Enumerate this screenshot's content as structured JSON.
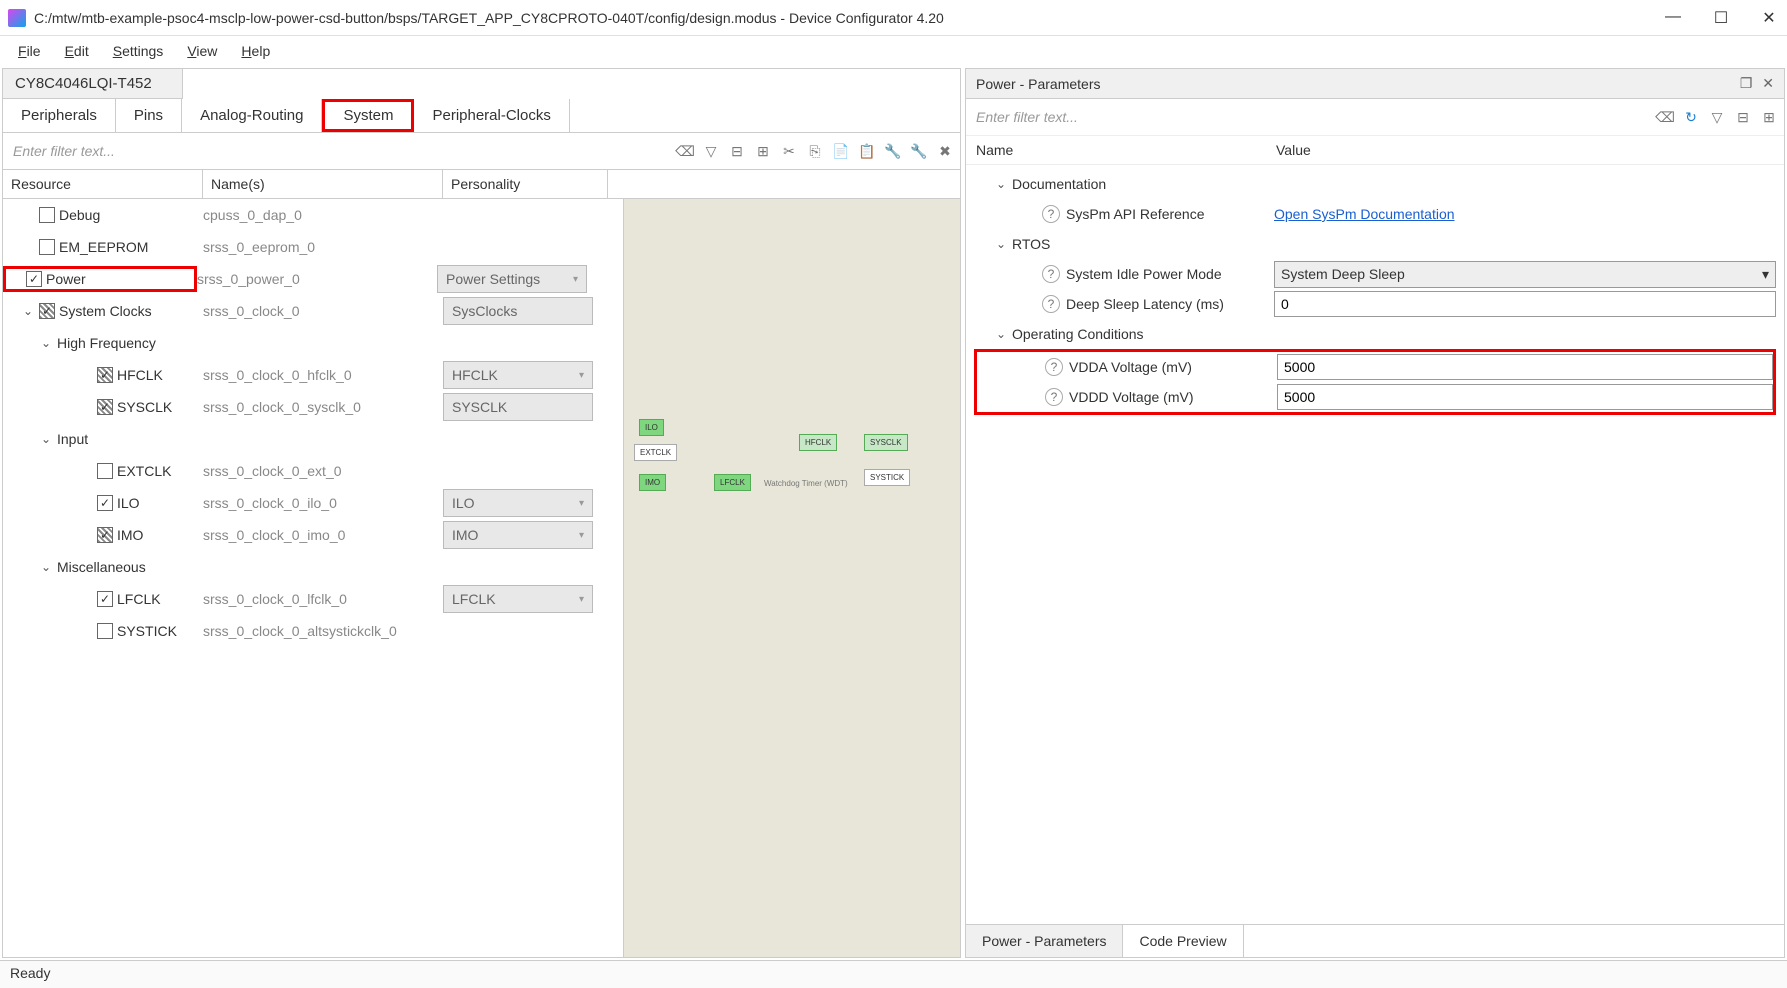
{
  "window": {
    "title": "C:/mtw/mtb-example-psoc4-msclp-low-power-csd-button/bsps/TARGET_APP_CY8CPROTO-040T/config/design.modus - Device Configurator 4.20"
  },
  "menu": [
    "File",
    "Edit",
    "Settings",
    "View",
    "Help"
  ],
  "device": "CY8C4046LQI-T452",
  "tabs": [
    "Peripherals",
    "Pins",
    "Analog-Routing",
    "System",
    "Peripheral-Clocks"
  ],
  "active_tab": "System",
  "filter_placeholder": "Enter filter text...",
  "tree_headers": {
    "resource": "Resource",
    "names": "Name(s)",
    "personality": "Personality"
  },
  "tree": [
    {
      "label": "Debug",
      "name": "cpuss_0_dap_0",
      "indent": 1,
      "checked": false
    },
    {
      "label": "EM_EEPROM",
      "name": "srss_0_eeprom_0",
      "indent": 1,
      "checked": false
    },
    {
      "label": "Power",
      "name": "srss_0_power_0",
      "indent": 1,
      "checked": true,
      "pers": "Power Settings",
      "highlight": true
    },
    {
      "label": "System Clocks",
      "name": "srss_0_clock_0",
      "indent": 1,
      "checked": "hatch",
      "pers": "SysClocks",
      "expander": "v"
    },
    {
      "label": "High Frequency",
      "indent": 2,
      "expander": "v"
    },
    {
      "label": "HFCLK",
      "name": "srss_0_clock_0_hfclk_0",
      "indent": 3,
      "checked": "hatch",
      "pers": "HFCLK"
    },
    {
      "label": "SYSCLK",
      "name": "srss_0_clock_0_sysclk_0",
      "indent": 3,
      "checked": "hatch",
      "pers": "SYSCLK"
    },
    {
      "label": "Input",
      "indent": 2,
      "expander": "v"
    },
    {
      "label": "EXTCLK",
      "name": "srss_0_clock_0_ext_0",
      "indent": 3,
      "checked": false
    },
    {
      "label": "ILO",
      "name": "srss_0_clock_0_ilo_0",
      "indent": 3,
      "checked": true,
      "pers": "ILO"
    },
    {
      "label": "IMO",
      "name": "srss_0_clock_0_imo_0",
      "indent": 3,
      "checked": "hatch",
      "pers": "IMO"
    },
    {
      "label": "Miscellaneous",
      "indent": 2,
      "expander": "v"
    },
    {
      "label": "LFCLK",
      "name": "srss_0_clock_0_lfclk_0",
      "indent": 3,
      "checked": true,
      "pers": "LFCLK"
    },
    {
      "label": "SYSTICK",
      "name": "srss_0_clock_0_altsystickclk_0",
      "indent": 3,
      "checked": false
    }
  ],
  "right": {
    "title": "Power - Parameters",
    "filter_placeholder": "Enter filter text...",
    "header_name": "Name",
    "header_value": "Value",
    "groups": {
      "documentation": "Documentation",
      "rtos": "RTOS",
      "operating": "Operating Conditions"
    },
    "doc_label": "SysPm API Reference",
    "doc_link": "Open SysPm Documentation",
    "rtos_idle_label": "System Idle Power Mode",
    "rtos_idle_value": "System Deep Sleep",
    "rtos_latency_label": "Deep Sleep Latency (ms)",
    "rtos_latency_value": "0",
    "vdda_label": "VDDA Voltage (mV)",
    "vdda_value": "5000",
    "vddd_label": "VDDD Voltage (mV)",
    "vddd_value": "5000",
    "bottom_tabs": [
      "Power - Parameters",
      "Code Preview"
    ]
  },
  "status": "Ready"
}
